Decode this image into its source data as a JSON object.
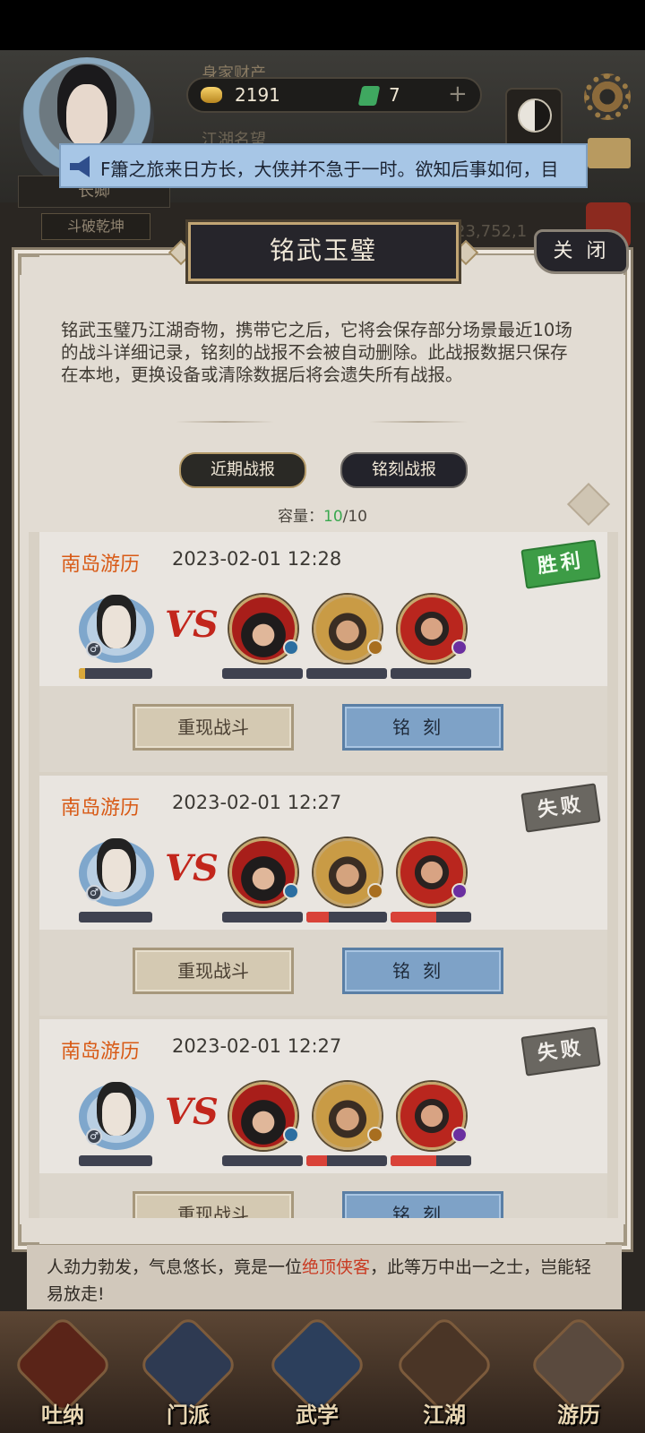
{
  "header": {
    "wealth_label": "身家财产",
    "gold": "2191",
    "gems": "7",
    "plus": "+",
    "fame_label": "江湖名望",
    "rank_title": "长卿",
    "rank_subtitle": "斗破乾坤",
    "power_text": "：23,752,1"
  },
  "notice": {
    "text": "F簫之旅来日方长，大侠并不急于一时。欲知后事如何，目"
  },
  "modal": {
    "title": "铭武玉璧",
    "close_label": "关 闭",
    "description": "铭武玉璧乃江湖奇物，携带它之后，它将会保存部分场景最近10场的战斗详细记录，铭刻的战报不会被自动删除。此战报数据只保存在本地，更换设备或清除数据后将会遗失所有战报。",
    "tabs": [
      {
        "label": "近期战报",
        "active": true
      },
      {
        "label": "铭刻战报",
        "active": false
      }
    ],
    "capacity_label": "容量：",
    "capacity_used": "10",
    "capacity_total": "/10"
  },
  "battles": [
    {
      "location": "南岛游历",
      "time": "2023-02-01 12:28",
      "result": "胜利",
      "hero_hp": 0.08,
      "enemy_hp": [
        0,
        0,
        0
      ],
      "replay_label": "重现战斗",
      "engrave_label": "铭刻"
    },
    {
      "location": "南岛游历",
      "time": "2023-02-01 12:27",
      "result": "失败",
      "hero_hp": 0,
      "enemy_hp": [
        0,
        0.28,
        0.57
      ],
      "replay_label": "重现战斗",
      "engrave_label": "铭刻"
    },
    {
      "location": "南岛游历",
      "time": "2023-02-01 12:27",
      "result": "失败",
      "hero_hp": 0,
      "enemy_hp": [
        0,
        0.25,
        0.57
      ],
      "replay_label": "重现战斗",
      "engrave_label": "铭刻"
    }
  ],
  "story": {
    "part1": "人劲力勃发，气息悠长，竟是一位",
    "highlight": "绝顶侠客",
    "part2": "，此等万中出一之士，岂能轻易放走!"
  },
  "nav": [
    {
      "label": "吐纳",
      "icon": "meditation-icon"
    },
    {
      "label": "门派",
      "icon": "sect-icon"
    },
    {
      "label": "武学",
      "icon": "martial-book-icon"
    },
    {
      "label": "江湖",
      "icon": "jianghu-icon"
    },
    {
      "label": "游历",
      "icon": "travel-horse-icon"
    }
  ],
  "colors": {
    "win": "#3d9c46",
    "lose": "#6a6761",
    "hp": "#d94238",
    "hero_hp": "#d9a83a",
    "location": "#d85a16"
  }
}
